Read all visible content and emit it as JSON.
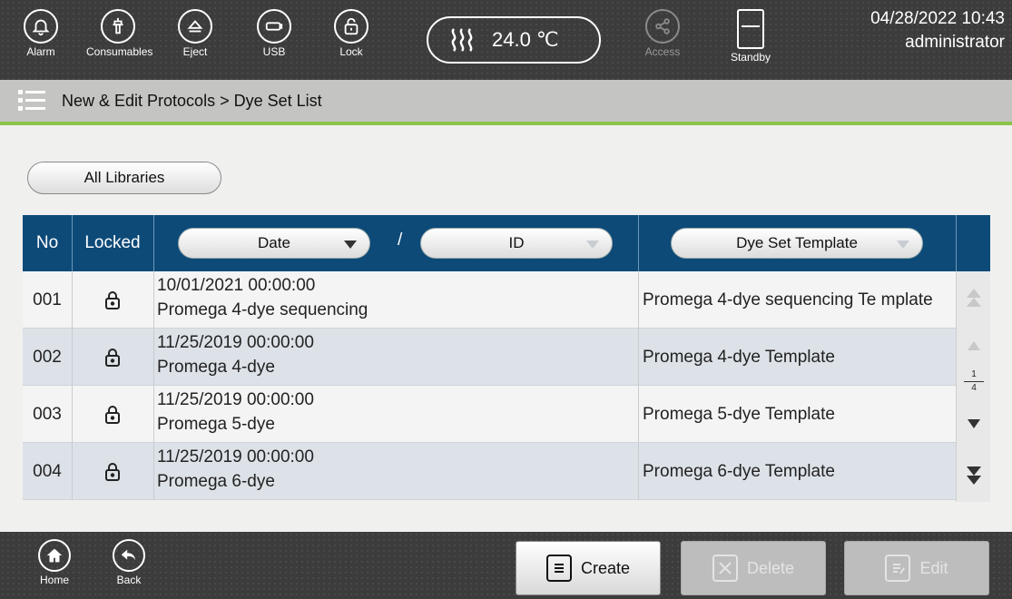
{
  "topbar": {
    "buttons": [
      {
        "label": "Alarm",
        "icon": "bell-icon"
      },
      {
        "label": "Consumables",
        "icon": "consumables-icon"
      },
      {
        "label": "Eject",
        "icon": "eject-icon"
      },
      {
        "label": "USB",
        "icon": "usb-icon"
      },
      {
        "label": "Lock",
        "icon": "lock-icon"
      }
    ],
    "temperature": "24.0 ℃",
    "access_label": "Access",
    "standby_label": "Standby",
    "datetime": "04/28/2022 10:43",
    "user": "administrator"
  },
  "breadcrumb": {
    "text": "New & Edit Protocols > Dye Set List"
  },
  "filter": {
    "all_libraries": "All Libraries"
  },
  "table": {
    "headers": {
      "no": "No",
      "locked": "Locked",
      "date": "Date",
      "separator": "/",
      "id": "ID",
      "template": "Dye Set Template"
    },
    "rows": [
      {
        "no": "001",
        "date": "10/01/2021 00:00:00",
        "id": "Promega 4-dye sequencing",
        "template": "Promega 4-dye sequencing Te mplate",
        "locked": true
      },
      {
        "no": "002",
        "date": "11/25/2019 00:00:00",
        "id": "Promega 4-dye",
        "template": "Promega 4-dye Template",
        "locked": true
      },
      {
        "no": "003",
        "date": "11/25/2019 00:00:00",
        "id": "Promega 5-dye",
        "template": "Promega 5-dye Template",
        "locked": true
      },
      {
        "no": "004",
        "date": "11/25/2019 00:00:00",
        "id": "Promega 6-dye",
        "template": "Promega 6-dye Template",
        "locked": true
      }
    ],
    "page_current": "1",
    "page_total": "4"
  },
  "bottombar": {
    "home_label": "Home",
    "back_label": "Back",
    "create_label": "Create",
    "delete_label": "Delete",
    "edit_label": "Edit"
  },
  "colors": {
    "header_bg": "#0d4a78",
    "accent_line": "#8bc34a",
    "bar_bg": "#3c3c3c"
  }
}
